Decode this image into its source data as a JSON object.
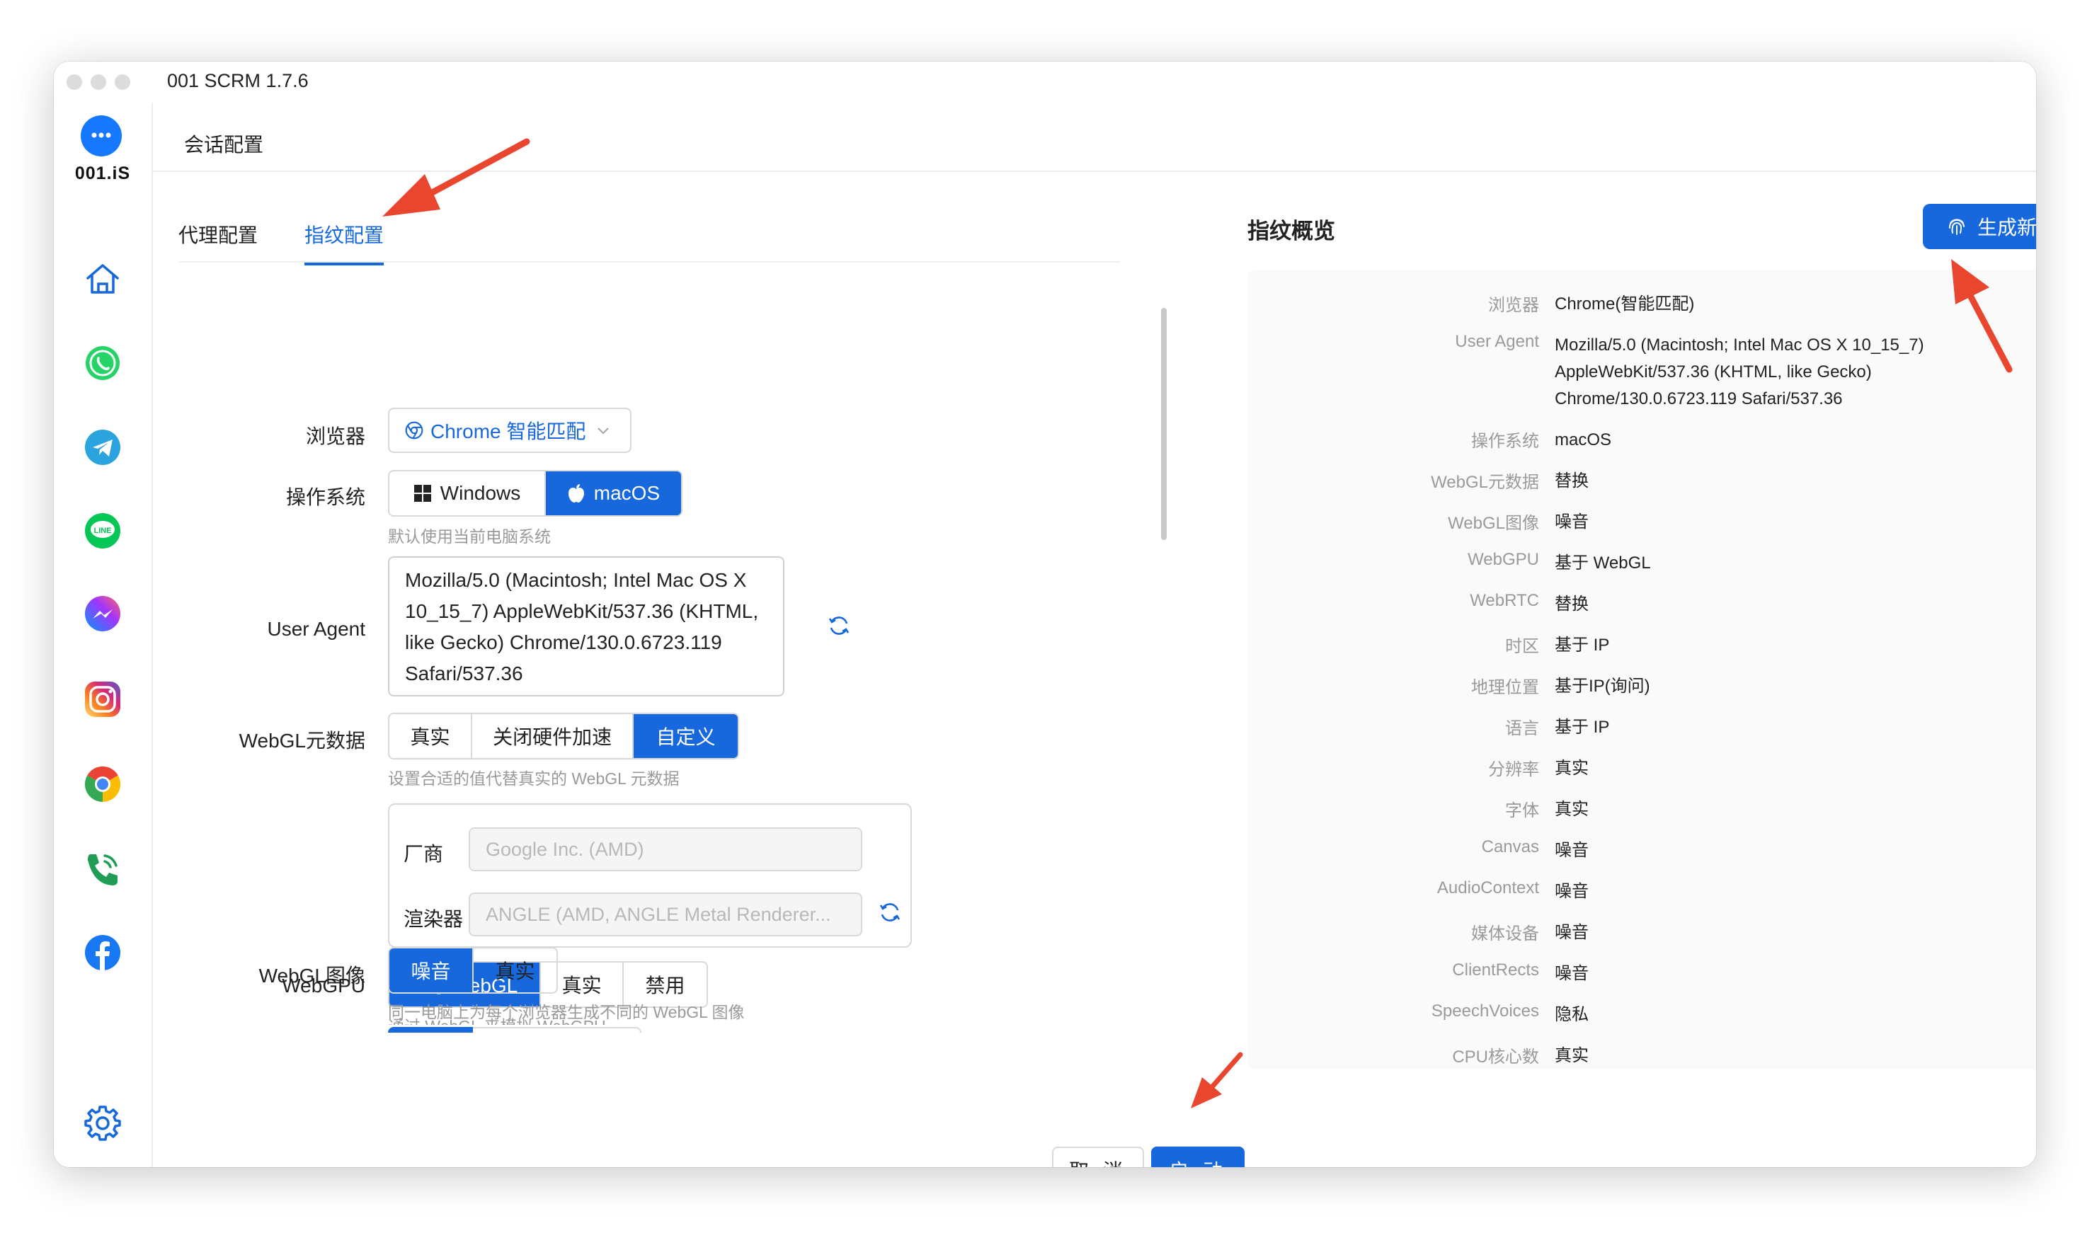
{
  "window": {
    "title": "001 SCRM 1.7.6"
  },
  "brand": {
    "logo_text": "001.iS"
  },
  "sidebar": {
    "items": [
      {
        "name": "home"
      },
      {
        "name": "whatsapp"
      },
      {
        "name": "telegram"
      },
      {
        "name": "line"
      },
      {
        "name": "messenger"
      },
      {
        "name": "instagram"
      },
      {
        "name": "chrome"
      },
      {
        "name": "phone"
      },
      {
        "name": "facebook"
      }
    ],
    "line_badge": "LINE"
  },
  "header": {
    "title": "会话配置"
  },
  "tabs": [
    {
      "label": "代理配置",
      "active": false
    },
    {
      "label": "指纹配置",
      "active": true
    }
  ],
  "form": {
    "browser": {
      "label": "浏览器",
      "value": "Chrome 智能匹配"
    },
    "os": {
      "label": "操作系统",
      "options": [
        "Windows",
        "macOS"
      ],
      "selected": "macOS",
      "hint": "默认使用当前电脑系统"
    },
    "user_agent": {
      "label": "User Agent",
      "value": "Mozilla/5.0 (Macintosh; Intel Mac OS X 10_15_7) AppleWebKit/537.36 (KHTML, like Gecko) Chrome/130.0.6723.119 Safari/537.36"
    },
    "webgl_meta": {
      "label": "WebGL元数据",
      "options": [
        "真实",
        "关闭硬件加速",
        "自定义"
      ],
      "selected": "自定义",
      "hint": "设置合适的值代替真实的 WebGL 元数据",
      "vendor_label": "厂商",
      "vendor_placeholder": "Google Inc. (AMD)",
      "renderer_label": "渲染器",
      "renderer_placeholder": "ANGLE (AMD, ANGLE Metal Renderer..."
    },
    "webgpu": {
      "label": "WebGPU",
      "options": [
        "基于WebGL",
        "真实",
        "禁用"
      ],
      "selected": "基于WebGL",
      "hint": "通过 WebGL 来模拟 WebGPU"
    },
    "webgl_image": {
      "label": "WebGL图像",
      "options": [
        "噪音",
        "真实"
      ],
      "selected": "噪音",
      "hint": "同一电脑上为每个浏览器生成不同的 WebGL 图像"
    }
  },
  "overview": {
    "title": "指纹概览",
    "generate_button": "生成新指纹",
    "rows": [
      {
        "key": "浏览器",
        "value": "Chrome(智能匹配)"
      },
      {
        "key": "User Agent",
        "value": "Mozilla/5.0 (Macintosh; Intel Mac OS X 10_15_7) AppleWebKit/537.36 (KHTML, like Gecko) Chrome/130.0.6723.119 Safari/537.36"
      },
      {
        "key": "操作系统",
        "value": "macOS"
      },
      {
        "key": "WebGL元数据",
        "value": "替换"
      },
      {
        "key": "WebGL图像",
        "value": "噪音"
      },
      {
        "key": "WebGPU",
        "value": "基于 WebGL"
      },
      {
        "key": "WebRTC",
        "value": "替换"
      },
      {
        "key": "时区",
        "value": "基于 IP"
      },
      {
        "key": "地理位置",
        "value": "基于IP(询问)"
      },
      {
        "key": "语言",
        "value": "基于 IP"
      },
      {
        "key": "分辨率",
        "value": "真实"
      },
      {
        "key": "字体",
        "value": "真实"
      },
      {
        "key": "Canvas",
        "value": "噪音"
      },
      {
        "key": "AudioContext",
        "value": "噪音"
      },
      {
        "key": "媒体设备",
        "value": "噪音"
      },
      {
        "key": "ClientRects",
        "value": "噪音"
      },
      {
        "key": "SpeechVoices",
        "value": "隐私"
      },
      {
        "key": "CPU核心数",
        "value": "真实"
      }
    ]
  },
  "footer": {
    "cancel": "取 消",
    "start": "启 动"
  },
  "colors": {
    "accent": "#1668dc",
    "annotation": "#e8462e"
  }
}
